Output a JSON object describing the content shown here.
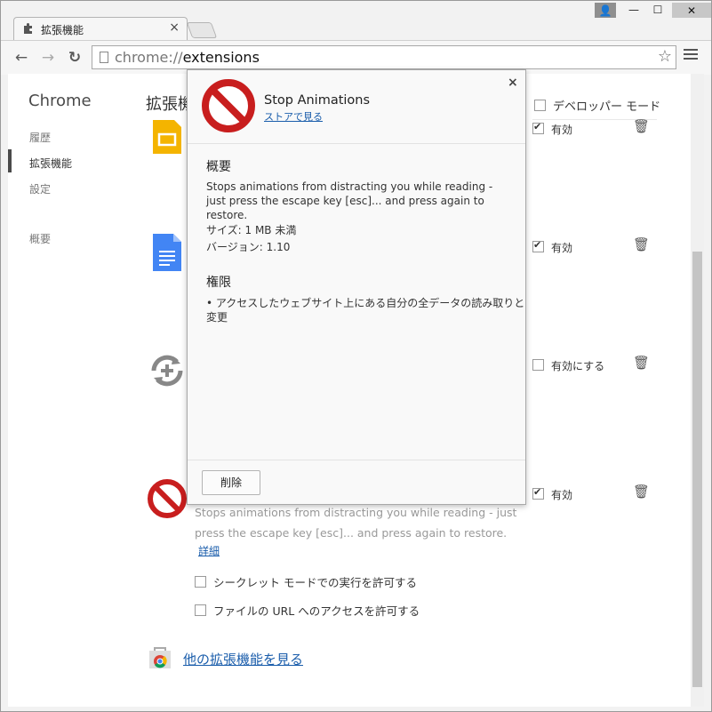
{
  "tab": {
    "title": "拡張機能",
    "close_glyph": "×"
  },
  "window_controls": {
    "user": "👤",
    "minimize": "—",
    "maximize": "☐",
    "close": "✕"
  },
  "toolbar": {
    "back": "←",
    "forward": "→",
    "reload": "↻",
    "url_scheme": "chrome://",
    "url_host": "extensions",
    "star": "☆"
  },
  "sidebar": {
    "title": "Chrome",
    "items": [
      {
        "label": "履歴"
      },
      {
        "label": "拡張機能"
      },
      {
        "label": "設定"
      },
      {
        "label": "概要"
      }
    ]
  },
  "main": {
    "title": "拡張機能",
    "developer_mode_label": "デベロッパー モード",
    "extensions": [
      {
        "status": "有効",
        "enabled": true
      },
      {
        "status": "有効",
        "enabled": true
      },
      {
        "status": "有効にする",
        "enabled": false
      },
      {
        "status": "有効",
        "enabled": true
      }
    ],
    "description": "Stops animations from distracting you while reading - just press the escape key [esc]... and press again to restore.",
    "details_link": "詳細",
    "option_incognito": "シークレット モードでの実行を許可する",
    "option_file_urls": "ファイルの URL へのアクセスを許可する",
    "more_extensions": "他の拡張機能を見る"
  },
  "dialog": {
    "name": "Stop Animations",
    "store_link": "ストアで見る",
    "close_glyph": "×",
    "overview_heading": "概要",
    "overview_text": "Stops animations from distracting you while reading - just press the escape key [esc]... and press again to restore.",
    "size": "サイズ: 1 MB 未満",
    "version": "バージョン: 1.10",
    "permissions_heading": "権限",
    "permission_item": "アクセスしたウェブサイト上にある自分の全データの読み取りと変更",
    "remove_button": "削除"
  },
  "colors": {
    "link": "#1a5dab",
    "block_red": "#c81e1e",
    "slides_yellow": "#f4b400",
    "docs_blue": "#4285f4"
  },
  "icons": [
    "puzzle-icon",
    "page-icon",
    "star-icon",
    "menu-icon",
    "slides-icon",
    "docs-icon",
    "sync-add-icon",
    "prohibition-icon",
    "trash-icon",
    "webstore-icon"
  ]
}
